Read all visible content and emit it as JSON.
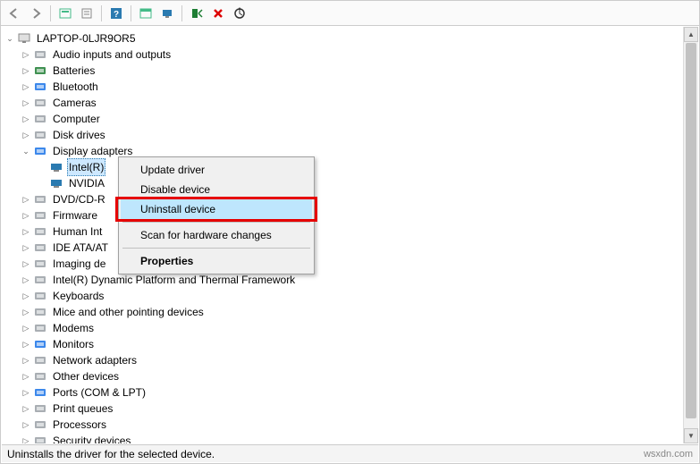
{
  "toolbar": {
    "back": "⇦",
    "forward": "⇨",
    "show_hidden": "▦",
    "properties": "☰",
    "help": "?",
    "action1": "▦",
    "monitor": "🖥",
    "install": "⬇",
    "remove": "✖",
    "scan": "⟳"
  },
  "root": {
    "label": "LAPTOP-0LJR9OR5"
  },
  "categories": [
    {
      "label": "Audio inputs and outputs",
      "expand": ">",
      "icon_color": "#9aa0a6"
    },
    {
      "label": "Batteries",
      "expand": ">",
      "icon_color": "#1e7e34"
    },
    {
      "label": "Bluetooth",
      "expand": ">",
      "icon_color": "#1a73e8"
    },
    {
      "label": "Cameras",
      "expand": ">",
      "icon_color": "#9aa0a6"
    },
    {
      "label": "Computer",
      "expand": ">",
      "icon_color": "#9aa0a6"
    },
    {
      "label": "Disk drives",
      "expand": ">",
      "icon_color": "#9aa0a6"
    },
    {
      "label": "Display adapters",
      "expand": "v",
      "icon_color": "#1a73e8"
    },
    {
      "label": "DVD/CD-R",
      "expand": ">",
      "icon_color": "#9aa0a6",
      "truncated": true
    },
    {
      "label": "Firmware",
      "expand": ">",
      "icon_color": "#9aa0a6",
      "truncated": true
    },
    {
      "label": "Human Int",
      "expand": ">",
      "icon_color": "#9aa0a6",
      "truncated": true
    },
    {
      "label": "IDE ATA/AT",
      "expand": ">",
      "icon_color": "#9aa0a6",
      "truncated": true
    },
    {
      "label": "Imaging de",
      "expand": ">",
      "icon_color": "#9aa0a6",
      "truncated": true
    },
    {
      "label": "Intel(R) Dynamic Platform and Thermal Framework",
      "expand": ">",
      "icon_color": "#9aa0a6"
    },
    {
      "label": "Keyboards",
      "expand": ">",
      "icon_color": "#9aa0a6"
    },
    {
      "label": "Mice and other pointing devices",
      "expand": ">",
      "icon_color": "#9aa0a6"
    },
    {
      "label": "Modems",
      "expand": ">",
      "icon_color": "#9aa0a6"
    },
    {
      "label": "Monitors",
      "expand": ">",
      "icon_color": "#1a73e8"
    },
    {
      "label": "Network adapters",
      "expand": ">",
      "icon_color": "#9aa0a6"
    },
    {
      "label": "Other devices",
      "expand": ">",
      "icon_color": "#9aa0a6"
    },
    {
      "label": "Ports (COM & LPT)",
      "expand": ">",
      "icon_color": "#1a73e8"
    },
    {
      "label": "Print queues",
      "expand": ">",
      "icon_color": "#9aa0a6"
    },
    {
      "label": "Processors",
      "expand": ">",
      "icon_color": "#9aa0a6"
    },
    {
      "label": "Security devices",
      "expand": ">",
      "icon_color": "#9aa0a6"
    }
  ],
  "display_children": [
    {
      "label": "Intel(R)",
      "selected": true
    },
    {
      "label": "NVIDIA"
    }
  ],
  "context_menu": {
    "items": [
      {
        "label": "Update driver"
      },
      {
        "label": "Disable device"
      },
      {
        "label": "Uninstall device",
        "hover": true,
        "highlight": true
      },
      {
        "sep": true
      },
      {
        "label": "Scan for hardware changes"
      },
      {
        "sep": true
      },
      {
        "label": "Properties",
        "bold": true
      }
    ]
  },
  "status": {
    "text": "Uninstalls the driver for the selected device.",
    "watermark": "wsxdn.com"
  }
}
